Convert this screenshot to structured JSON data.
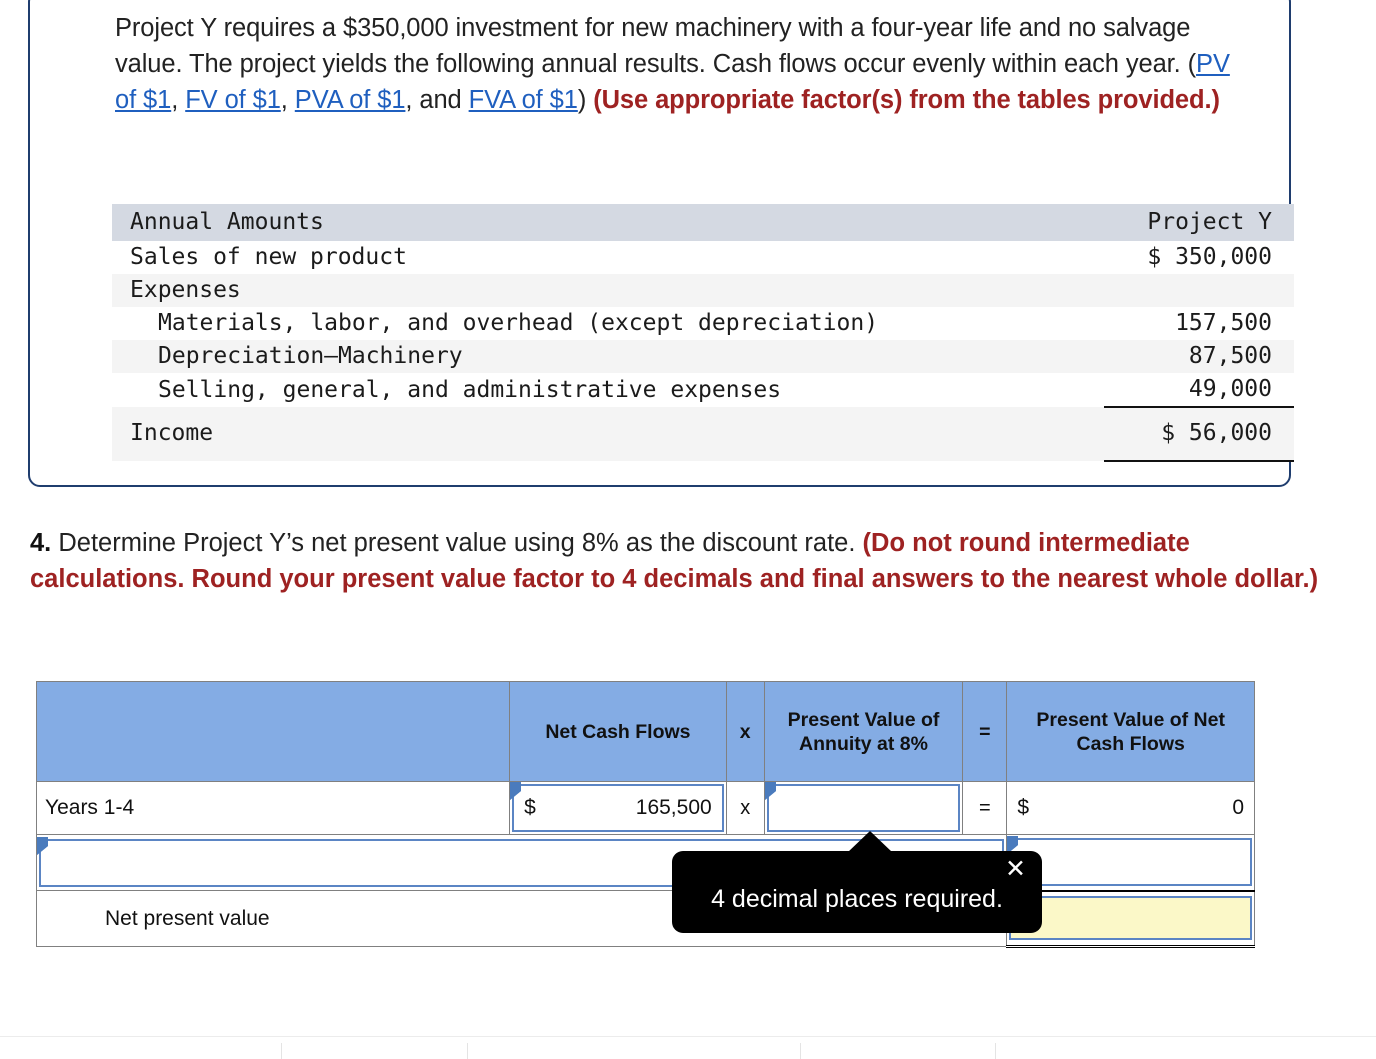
{
  "problem": {
    "part1": "Project Y requires a $350,000 investment for new machinery with a four-year life and no salvage value. The project yields the following annual results. Cash flows occur evenly within each year. (",
    "links": [
      "PV of $1",
      "FV of $1",
      "PVA of $1",
      "FVA of $1"
    ],
    "sep1": ", ",
    "sep2": ", ",
    "sep3": ", and ",
    "close_paren": ") ",
    "instruction": "(Use appropriate factor(s) from the tables provided.)"
  },
  "amounts_table": {
    "header": {
      "label": "Annual Amounts",
      "value": "Project Y"
    },
    "rows": [
      {
        "label": "Sales of new product",
        "value": "$ 350,000",
        "indent": 0
      },
      {
        "label": "Expenses",
        "value": "",
        "indent": 0
      },
      {
        "label": "Materials, labor, and overhead (except depreciation)",
        "value": "157,500",
        "indent": 1
      },
      {
        "label": "Depreciation—Machinery",
        "value": "87,500",
        "indent": 1
      },
      {
        "label": "Selling, general, and administrative expenses",
        "value": "49,000",
        "indent": 1
      },
      {
        "label": "Income",
        "value": "$ 56,000",
        "indent": 0
      }
    ]
  },
  "question": {
    "number": "4.",
    "text": " Determine Project Y’s net present value using 8% as the discount rate. ",
    "emphasis": "(Do not round intermediate calculations. Round your present value factor to 4 decimals and final answers to the nearest whole dollar.)"
  },
  "npv_table": {
    "headers": {
      "blank": "",
      "net_cash_flows": "Net Cash Flows",
      "times": "x",
      "pv_annuity": "Present Value of Annuity at 8%",
      "equals": "=",
      "pv_net_cash_flows": "Present Value of Net Cash Flows"
    },
    "rows": [
      {
        "label": "Years 1-4",
        "ncf_dollar": "$",
        "ncf_value": "165,500",
        "times": "x",
        "pva_value": "",
        "equals": "=",
        "pv_dollar": "$",
        "pv_value": "0"
      },
      {
        "label": "",
        "ncf_dollar": "",
        "ncf_value": "",
        "times": "",
        "pva_value": "",
        "equals": "",
        "pv_dollar": "",
        "pv_value": ""
      },
      {
        "label": "Net present value",
        "ncf_dollar": "",
        "ncf_value": "",
        "times": "",
        "pva_value": "",
        "equals": "",
        "pv_dollar": "",
        "pv_value": ""
      }
    ]
  },
  "tooltip": {
    "message": "4 decimal places required.",
    "close": "✕"
  },
  "colors": {
    "box_border": "#1f3d6e",
    "link": "#1f5fbf",
    "emphasis_red": "#9e2222",
    "table_header_gray": "#d4d9e2",
    "blue_header": "#84ace4",
    "input_border": "#5b85c4",
    "highlight_yellow": "#fbf8c8",
    "tooltip_bg": "#000000"
  }
}
